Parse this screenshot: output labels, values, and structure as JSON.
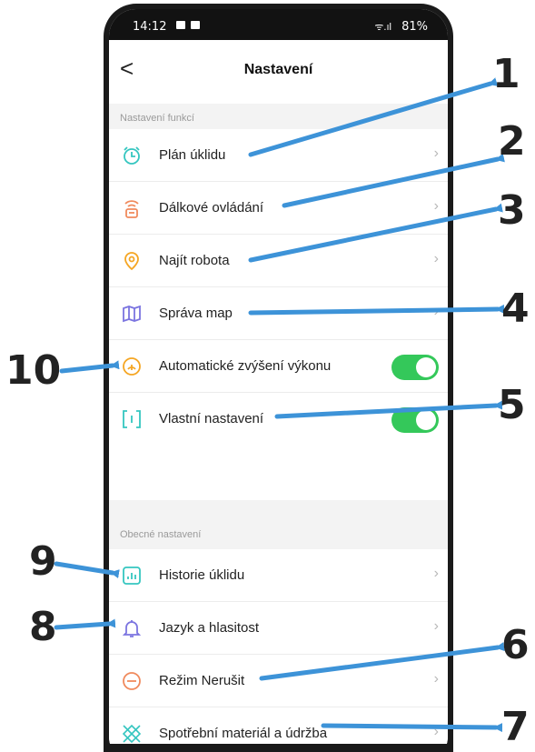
{
  "status_bar": {
    "time": "14:12",
    "battery": "81%",
    "signal": "ᯤ.ıl"
  },
  "header": {
    "back_glyph": "<",
    "title": "Nastavení"
  },
  "sections": [
    {
      "label": "Nastavení funkcí"
    },
    {
      "label": "Obecné nastavení"
    }
  ],
  "rows": [
    {
      "label": "Plán úklidu",
      "icon": "alarm-clock-icon",
      "color": "#35c6c0",
      "control": "chevron"
    },
    {
      "label": "Dálkové ovládání",
      "icon": "remote-control-icon",
      "color": "#f08a5d",
      "control": "chevron"
    },
    {
      "label": "Najít robota",
      "icon": "location-pin-icon",
      "color": "#f5a623",
      "control": "chevron"
    },
    {
      "label": "Správa map",
      "icon": "map-icon",
      "color": "#7b74e0",
      "control": "chevron"
    },
    {
      "label": "Automatické zvýšení výkonu",
      "icon": "power-boost-icon",
      "color": "#f5a623",
      "control": "toggle",
      "on": true
    },
    {
      "label": "Vlastní nastavení",
      "icon": "custom-settings-icon",
      "color": "#35c6c0",
      "control": "toggle",
      "on": true
    },
    {
      "label": "Historie úklidu",
      "icon": "history-chart-icon",
      "color": "#35c6c0",
      "control": "chevron"
    },
    {
      "label": "Jazyk a hlasitost",
      "icon": "bell-icon",
      "color": "#7b74e0",
      "control": "chevron"
    },
    {
      "label": "Režim Nerušit",
      "icon": "do-not-disturb-icon",
      "color": "#f08a5d",
      "control": "chevron"
    },
    {
      "label": "Spotřební materiál a údržba",
      "icon": "consumables-icon",
      "color": "#35c6c0",
      "control": "chevron"
    }
  ],
  "chevron": "›",
  "callouts": [
    "1",
    "2",
    "3",
    "4",
    "5",
    "6",
    "7",
    "8",
    "9",
    "10"
  ],
  "colors": {
    "arrow": "#3d93d8",
    "toggle_on": "#34c85a"
  }
}
